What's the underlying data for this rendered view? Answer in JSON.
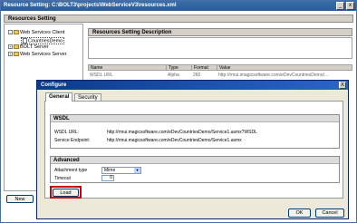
{
  "window": {
    "title": "Resource Setting: C:\\BOLT3\\projects\\WebServiceV3\\resources.xml",
    "minimize": "_",
    "close": "x"
  },
  "resources_panel": {
    "header": "Resources Setting",
    "tree": [
      {
        "label": "Web Services Client",
        "expander": "-"
      },
      {
        "label": "CountriesDemo"
      },
      {
        "label": "BOLT Server",
        "expander": "+"
      },
      {
        "label": "Web Services Server",
        "expander": "+"
      }
    ]
  },
  "description_panel": {
    "header": "Resources Setting Description"
  },
  "table": {
    "columns": [
      "Name",
      "Type",
      "Format",
      "Value"
    ],
    "row": {
      "name": "WSDL URL",
      "type": "Alpha",
      "format": "260",
      "value": "http://rmui.imagicsoftware.com/eDevCountriesDemo/..."
    }
  },
  "new_button": "New",
  "dialog": {
    "title": "Configure",
    "close": "X",
    "tabs": [
      "General",
      "Security"
    ],
    "wsdl": {
      "header": "WSDL",
      "url_label": "WSDL URL:",
      "url_value": "http://rmui.magicsoftware.com/eDevCountriesDemo/Service1.asmx?WSDL",
      "endpoint_label": "Service Endpoint:",
      "endpoint_value": "http://rmui.magicsoftware.com/eDevCountriesDemo/Service1.asmx"
    },
    "advanced": {
      "header": "Advanced",
      "attachment_label": "Attachment type",
      "attachment_value": "Mime",
      "timeout_label": "Timeout",
      "timeout_value": "0"
    },
    "load_button": "Load",
    "ok_button": "OK",
    "cancel_button": "Cancel"
  },
  "colors": {
    "title_bar": "#2b5c9c",
    "dialog_title": "#0a3a8a",
    "highlight_border": "#d00000"
  }
}
